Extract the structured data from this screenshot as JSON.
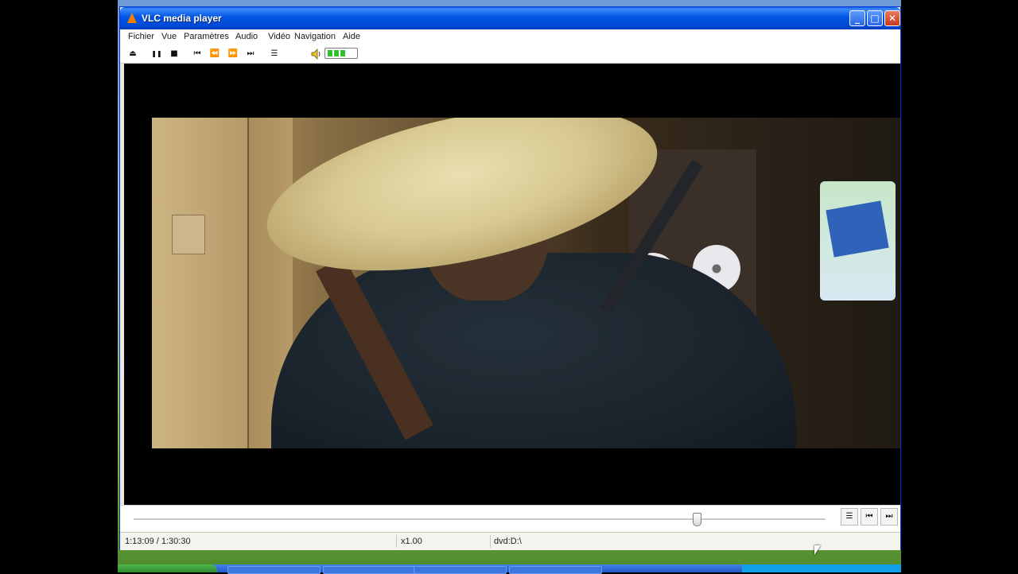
{
  "window": {
    "title": "VLC media player",
    "controls": {
      "minimize": "_",
      "maximize": "□",
      "close": "✕"
    }
  },
  "menubar": [
    "Fichier",
    "Vue",
    "Paramètres",
    "Audio",
    "Vidéo",
    "Navigation",
    "Aide"
  ],
  "toolbar": {
    "icons": [
      "eject-icon",
      "pause-icon",
      "stop-icon",
      "skip-back-icon",
      "rewind-icon",
      "fast-forward-icon",
      "skip-forward-icon",
      "playlist-icon",
      "volume-icon"
    ],
    "glyphs": {
      "eject": "⏏",
      "pause": "❚❚",
      "stop": "■",
      "prev": "⏮",
      "rewind": "⏪",
      "forward": "⏩",
      "next": "⏭",
      "playlist": "☰"
    },
    "volume_level": 0.6
  },
  "seek": {
    "progress": 0.8137,
    "glyphs": {
      "playlist": "☰",
      "prev": "⏮",
      "next": "⏭"
    }
  },
  "status": {
    "time": "1:13:09 / 1:30:30",
    "speed": "x1.00",
    "source": "dvd:D:\\"
  },
  "colors": {
    "titlebar": "#0055e5",
    "volume_fill": "#2fc02f",
    "vlc_orange": "#f57d00"
  }
}
